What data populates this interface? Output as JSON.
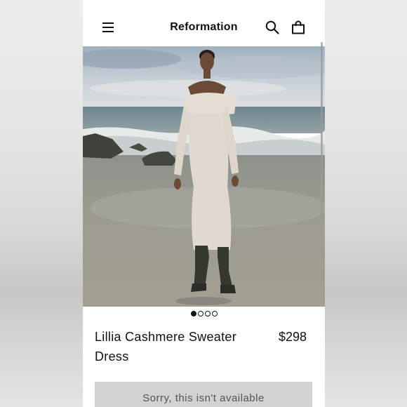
{
  "header": {
    "brand": "Reformation",
    "menu_icon": "hamburger-menu-icon",
    "search_icon": "search-icon",
    "bag_icon": "shopping-bag-icon"
  },
  "gallery": {
    "image_count": 4,
    "active_index": 0
  },
  "product": {
    "name": "Lillia Cashmere Sweater Dress",
    "price": "$298",
    "availability_label": "Sorry, this isn't available"
  },
  "colors": {
    "text": "#111111",
    "button_bg": "#d2d2d0",
    "button_text": "#555555"
  }
}
